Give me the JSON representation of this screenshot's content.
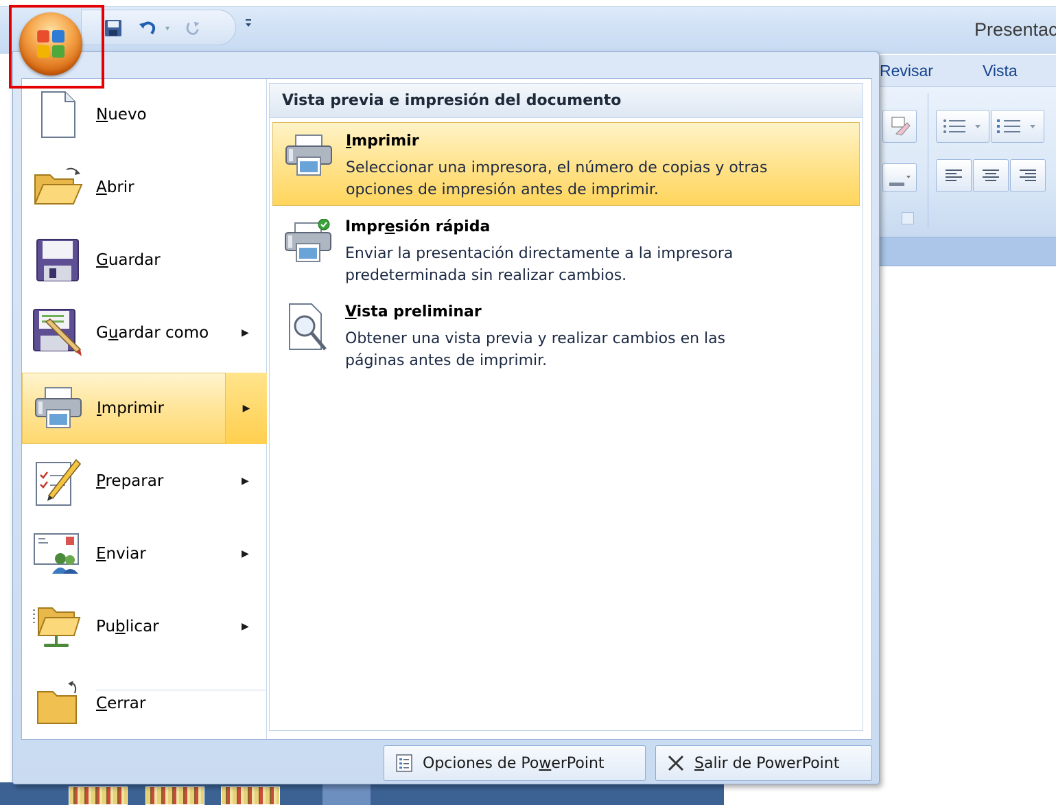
{
  "window": {
    "title": "Presentac"
  },
  "ribbon_tabs": [
    "Revisar",
    "Vista"
  ],
  "office_menu": {
    "left_items": [
      {
        "pre": "",
        "u": "N",
        "post": "uevo",
        "icon": "new-document-icon",
        "submenu": false
      },
      {
        "pre": "",
        "u": "A",
        "post": "brir",
        "icon": "open-folder-icon",
        "submenu": false
      },
      {
        "pre": "",
        "u": "G",
        "post": "uardar",
        "icon": "floppy-disk-icon",
        "submenu": false
      },
      {
        "pre": "G",
        "u": "u",
        "post": "ardar como",
        "icon": "save-as-icon",
        "submenu": true
      },
      {
        "pre": "",
        "u": "I",
        "post": "mprimir",
        "icon": "printer-icon",
        "submenu": true,
        "selected": true
      },
      {
        "pre": "",
        "u": "P",
        "post": "reparar",
        "icon": "prepare-pencil-icon",
        "submenu": true
      },
      {
        "pre": "",
        "u": "E",
        "post": "nviar",
        "icon": "send-envelope-icon",
        "submenu": true
      },
      {
        "pre": "Pu",
        "u": "b",
        "post": "licar",
        "icon": "publish-folder-icon",
        "submenu": true
      },
      {
        "pre": "",
        "u": "C",
        "post": "errar",
        "icon": "close-folder-icon",
        "submenu": false
      }
    ],
    "right_panel": {
      "header": "Vista previa e impresión del documento",
      "items": [
        {
          "title_pre": "",
          "title_u": "I",
          "title_post": "mprimir",
          "desc_line1": "Seleccionar una impresora, el número de copias y otras",
          "desc_line2": "opciones de impresión antes de imprimir.",
          "icon": "printer-icon",
          "selected": true
        },
        {
          "title_pre": "Impr",
          "title_u": "e",
          "title_post": "sión rápida",
          "desc_line1": "Enviar la presentación directamente a la impresora",
          "desc_line2": "predeterminada sin realizar cambios.",
          "icon": "quick-print-icon",
          "selected": false
        },
        {
          "title_pre": "",
          "title_u": "V",
          "title_post": "ista preliminar",
          "desc_line1": "Obtener una vista previa y realizar cambios en las",
          "desc_line2": "páginas antes de imprimir.",
          "icon": "print-preview-magnifier-icon",
          "selected": false
        }
      ]
    },
    "footer": {
      "options": {
        "pre": "Opciones de Po",
        "u": "w",
        "post": "erPoint",
        "icon": "options-icon"
      },
      "exit": {
        "pre": "",
        "u": "S",
        "post": "alir de PowerPoint",
        "icon": "close-x-icon"
      }
    }
  },
  "colors": {
    "selection": "#ffd86e",
    "highlight_box": "#e40000",
    "menu_background": "#c9dbf1",
    "orb": "#d86a12"
  }
}
